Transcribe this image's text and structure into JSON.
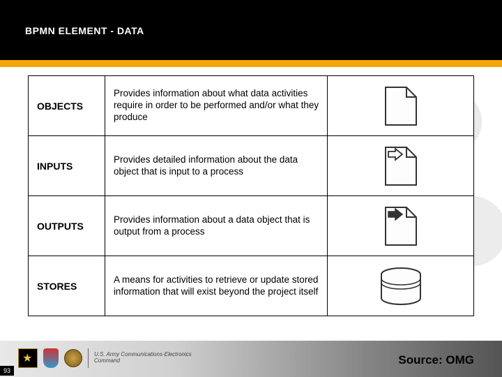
{
  "header": {
    "title": "BPMN ELEMENT - DATA"
  },
  "rows": [
    {
      "name": "OBJECTS",
      "desc": "Provides information about what data activities require in order to be performed and/or what they produce"
    },
    {
      "name": "INPUTS",
      "desc": "Provides detailed information about the data object that is input to a process"
    },
    {
      "name": "OUTPUTS",
      "desc": "Provides information about a data object that is output from a process"
    },
    {
      "name": "STORES",
      "desc": "A means for activities to retrieve or update stored information that will exist beyond the project itself"
    }
  ],
  "footer": {
    "page_number": "93",
    "org_text": "U.S. Army Communications-Electronics Command",
    "source_label": "Source: OMG"
  }
}
